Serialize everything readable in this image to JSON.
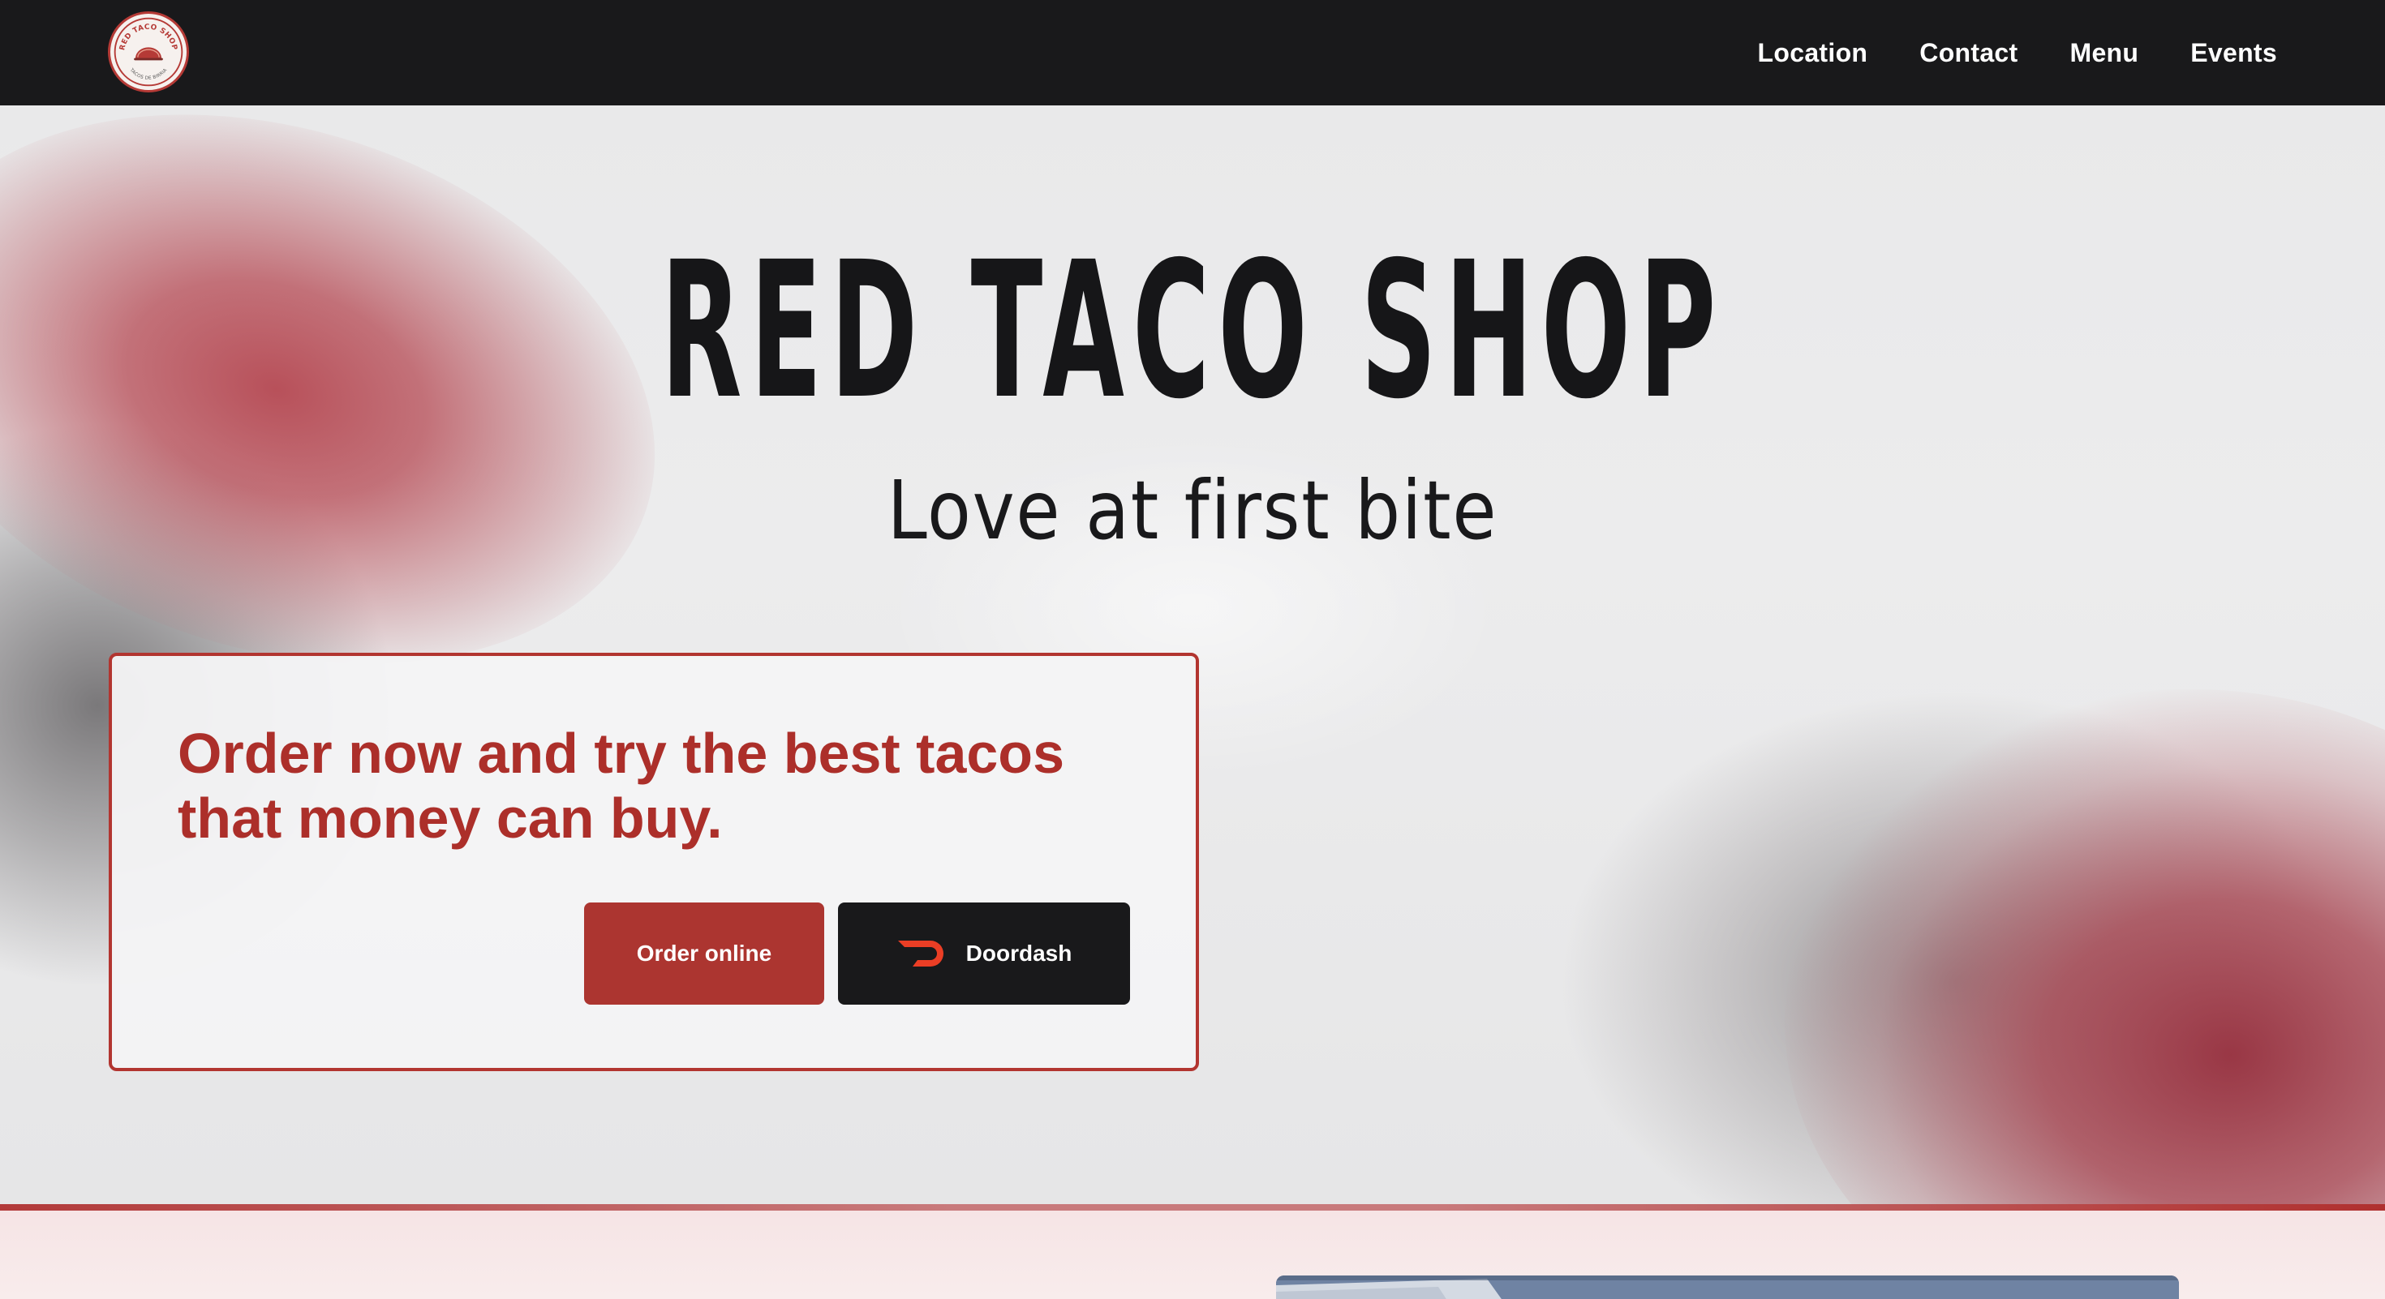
{
  "header": {
    "logo": {
      "top_text": "RED TACO SHOP",
      "bottom_text": "TACOS DE BIRRIA",
      "icon": "taco-logo-icon"
    },
    "nav": [
      {
        "label": "Location"
      },
      {
        "label": "Contact"
      },
      {
        "label": "Menu"
      },
      {
        "label": "Events"
      }
    ]
  },
  "hero": {
    "title": "RED TACO SHOP",
    "subtitle": "Love at first bite"
  },
  "order_card": {
    "text": "Order now and try the best tacos that money can buy.",
    "order_button_label": "Order online",
    "doordash_button_label": "Doordash",
    "doordash_icon": "doordash-logo-icon"
  },
  "colors": {
    "brand_red": "#ac2f2a",
    "nav_bg": "#19191b",
    "doordash_red": "#eb3e25"
  }
}
